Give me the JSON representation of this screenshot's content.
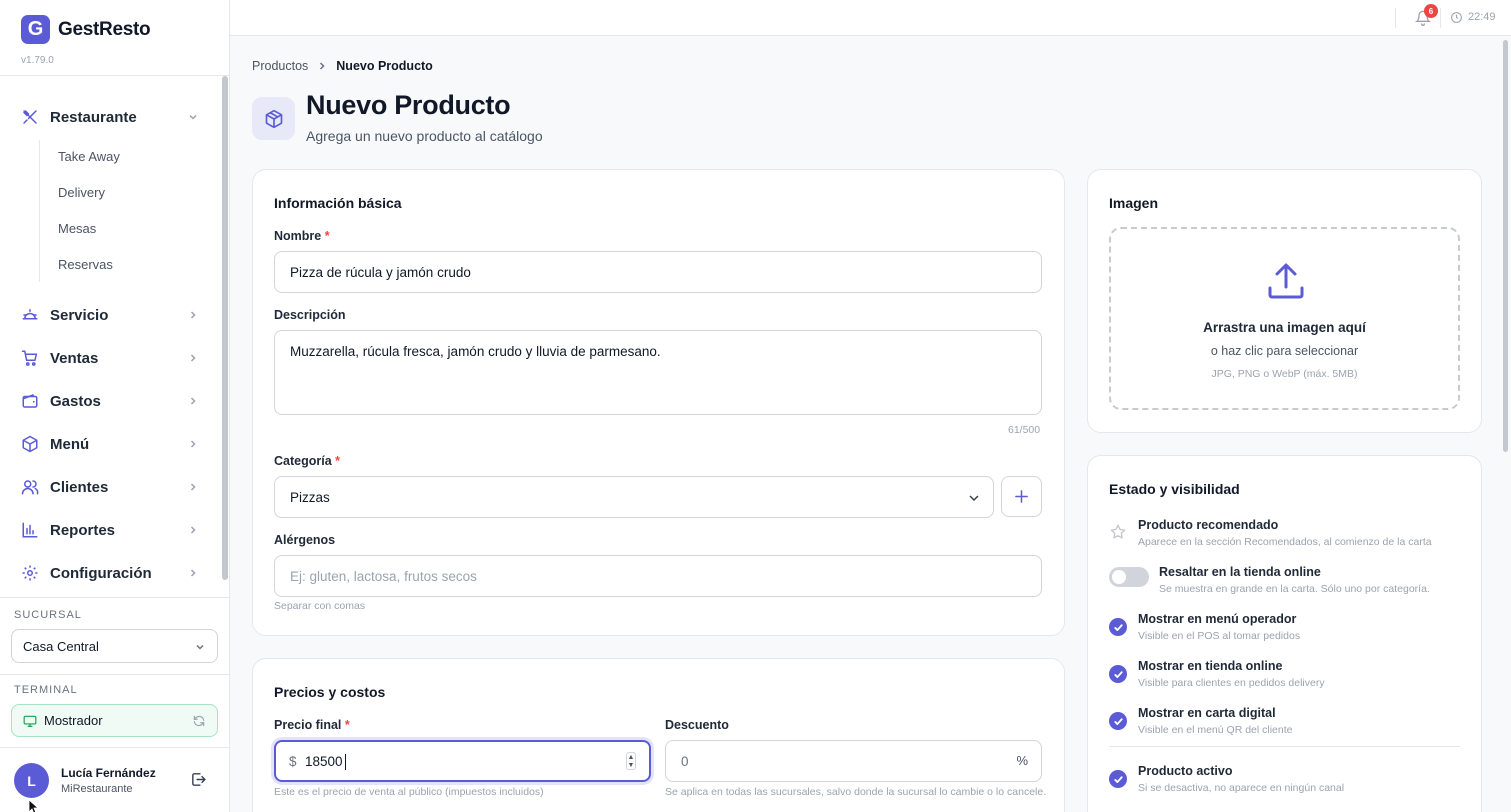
{
  "app": {
    "logo_letter": "G",
    "name": "GestResto",
    "version": "v1.79.0"
  },
  "sidebar": {
    "restaurant": {
      "label": "Restaurante",
      "subitems": [
        "Take Away",
        "Delivery",
        "Mesas",
        "Reservas"
      ]
    },
    "items": [
      {
        "label": "Servicio",
        "icon": "bell-service-icon"
      },
      {
        "label": "Ventas",
        "icon": "cart-icon"
      },
      {
        "label": "Gastos",
        "icon": "wallet-icon"
      },
      {
        "label": "Menú",
        "icon": "box-icon"
      },
      {
        "label": "Clientes",
        "icon": "users-icon"
      },
      {
        "label": "Reportes",
        "icon": "bar-chart-icon"
      },
      {
        "label": "Configuración",
        "icon": "gear-icon"
      }
    ],
    "branch_label": "SUCURSAL",
    "branch_value": "Casa Central",
    "terminal_label": "TERMINAL",
    "terminal_value": "Mostrador",
    "user": {
      "initial": "L",
      "name": "Lucía Fernández",
      "org": "MiRestaurante"
    }
  },
  "topbar": {
    "notifications": "6",
    "time": "22:49"
  },
  "breadcrumb": {
    "parent": "Productos",
    "current": "Nuevo Producto"
  },
  "header": {
    "title": "Nuevo Producto",
    "subtitle": "Agrega un nuevo producto al catálogo"
  },
  "basic": {
    "title": "Información básica",
    "name_label": "Nombre",
    "name_value": "Pizza de rúcula y jamón crudo",
    "desc_label": "Descripción",
    "desc_value": "Muzzarella, rúcula fresca, jamón crudo y lluvia de parmesano.",
    "desc_count": "61/500",
    "category_label": "Categoría",
    "category_value": "Pizzas",
    "allergens_label": "Alérgenos",
    "allergens_placeholder": "Ej: gluten, lactosa, frutos secos",
    "allergens_hint": "Separar con comas"
  },
  "pricing": {
    "title": "Precios y costos",
    "price_label": "Precio final",
    "currency": "$",
    "price_value": "18500",
    "price_hint": "Este es el precio de venta al público (impuestos incluidos)",
    "discount_label": "Descuento",
    "discount_value": "0",
    "discount_unit": "%",
    "discount_hint": "Se aplica en todas las sucursales, salvo donde la sucursal lo cambie o lo cancele."
  },
  "image": {
    "title": "Imagen",
    "drop_title": "Arrastra una imagen aquí",
    "drop_sub": "o haz clic para seleccionar",
    "drop_hint": "JPG, PNG o WebP (máx. 5MB)"
  },
  "visibility": {
    "title": "Estado y visibilidad",
    "options": [
      {
        "title": "Producto recomendado",
        "sub": "Aparece en la sección Recomendados, al comienzo de la carta",
        "control": "star-icon"
      },
      {
        "title": "Resaltar en la tienda online",
        "sub": "Se muestra en grande en la carta. Sólo uno por categoría.",
        "control": "toggle-off"
      },
      {
        "title": "Mostrar en menú operador",
        "sub": "Visible en el POS al tomar pedidos",
        "control": "check-icon"
      },
      {
        "title": "Mostrar en tienda online",
        "sub": "Visible para clientes en pedidos delivery",
        "control": "check-icon"
      },
      {
        "title": "Mostrar en carta digital",
        "sub": "Visible en el menú QR del cliente",
        "control": "check-icon"
      },
      {
        "title": "Producto activo",
        "sub": "Si se desactiva, no aparece en ningún canal",
        "control": "check-icon"
      }
    ]
  },
  "colors": {
    "accent": "#5b5bd6",
    "danger": "#ef4444",
    "success": "#16a34a"
  }
}
